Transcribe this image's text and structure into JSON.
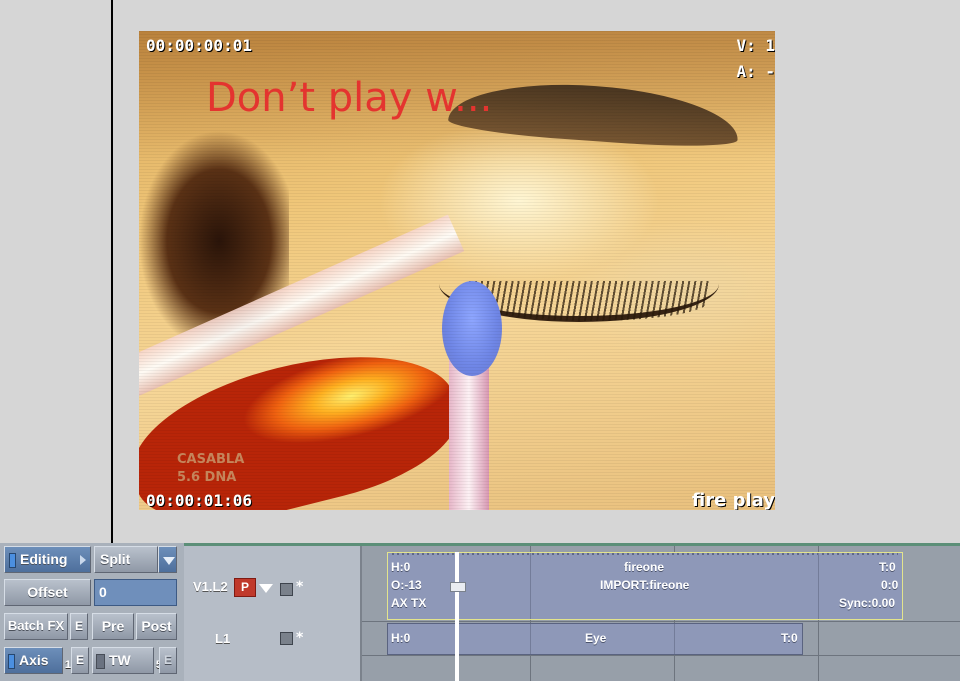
{
  "video": {
    "timecode_top": "00:00:00:01",
    "timecode_bottom": "00:00:01:06",
    "v_label": "V: 1",
    "a_label": "A: -",
    "burn_in_title": "Don’t play w...",
    "corner_text": "fire play",
    "background_logo_line1": "CASABLA",
    "background_logo_line2": "5.6 DNA"
  },
  "controls": {
    "editing_label": "Editing",
    "split_label": "Split",
    "offset_label": "Offset",
    "offset_value": "0",
    "batchfx_label": "Batch FX",
    "e_label": "E",
    "pre_label": "Pre",
    "post_label": "Post",
    "axis_label": "Axis",
    "axis_count": "1",
    "tw_label": "TW",
    "tw_count": "5"
  },
  "timeline": {
    "video_track_label": "V1.L2",
    "priority_badge": "P",
    "audio_track_label": "L1",
    "star": "*",
    "video_clip": {
      "head": "H:0",
      "offset": "O:-13",
      "transition": "AX TX",
      "name": "fireone",
      "source": "IMPORT:fireone",
      "tail": "T:0",
      "tail_offset": "0:0",
      "sync": "Sync:0.00"
    },
    "audio_clip": {
      "head": "H:0",
      "name": "Eye",
      "tail": "T:0"
    }
  },
  "colors": {
    "burn_in_title": "#e4342f",
    "panel": "#a9b1bb",
    "clip": "#8e98b8",
    "clip_border_selected": "#e3e48c",
    "priority_badge": "#c0392b"
  }
}
